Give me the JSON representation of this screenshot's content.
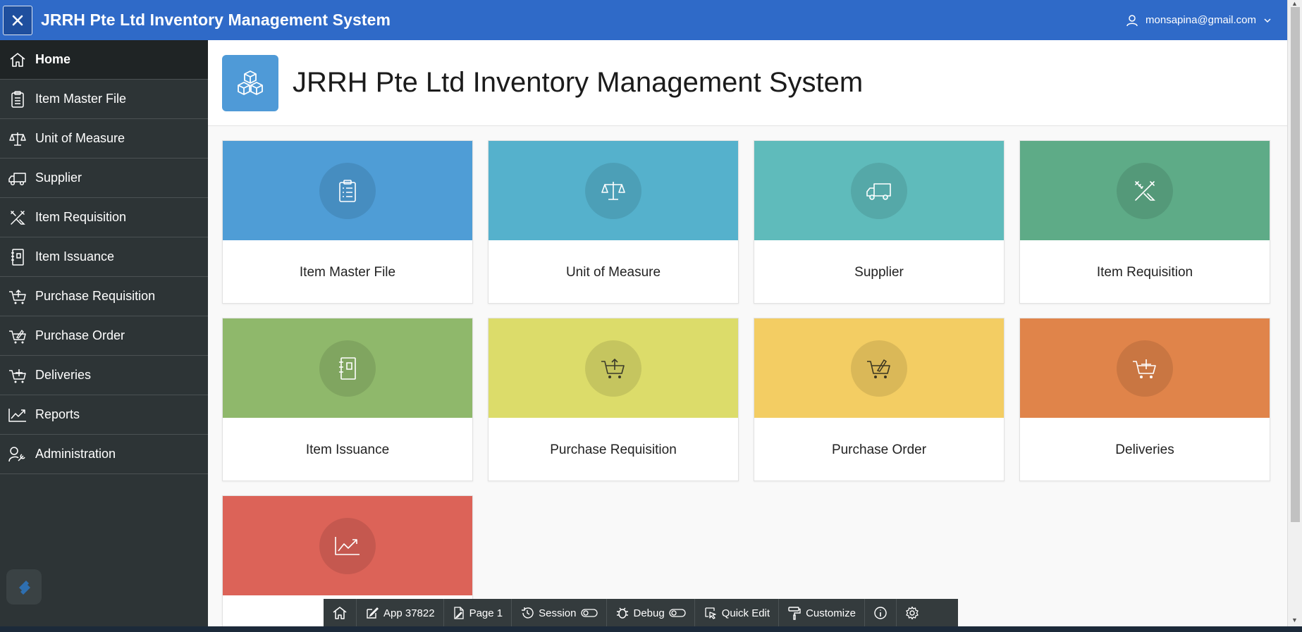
{
  "header": {
    "title": "JRRH Pte Ltd Inventory Management System",
    "user_email": "monsapina@gmail.com"
  },
  "sidebar": {
    "items": [
      {
        "label": "Home",
        "icon": "home-icon",
        "active": true
      },
      {
        "label": "Item Master File",
        "icon": "clipboard-list-icon"
      },
      {
        "label": "Unit of Measure",
        "icon": "balance-scale-icon"
      },
      {
        "label": "Supplier",
        "icon": "truck-icon"
      },
      {
        "label": "Item Requisition",
        "icon": "pencil-ruler-icon"
      },
      {
        "label": "Item Issuance",
        "icon": "notebook-icon"
      },
      {
        "label": "Purchase Requisition",
        "icon": "cart-upload-icon"
      },
      {
        "label": "Purchase Order",
        "icon": "cart-edit-icon"
      },
      {
        "label": "Deliveries",
        "icon": "cart-add-icon"
      },
      {
        "label": "Reports",
        "icon": "line-chart-icon"
      },
      {
        "label": "Administration",
        "icon": "user-wrench-icon"
      }
    ]
  },
  "hero": {
    "title": "JRRH Pte Ltd Inventory Management System",
    "icon": "cubes-icon"
  },
  "cards": [
    {
      "label": "Item Master File",
      "color": "#4f9dd6",
      "icon": "clipboard-list-icon"
    },
    {
      "label": "Unit of Measure",
      "color": "#55b1cc",
      "icon": "balance-scale-icon"
    },
    {
      "label": "Supplier",
      "color": "#5fbbbb",
      "icon": "truck-icon"
    },
    {
      "label": "Item Requisition",
      "color": "#5eab87",
      "icon": "pencil-ruler-icon"
    },
    {
      "label": "Item Issuance",
      "color": "#8fb86b",
      "icon": "notebook-icon"
    },
    {
      "label": "Purchase Requisition",
      "color": "#dcdc6a",
      "icon": "cart-upload-icon"
    },
    {
      "label": "Purchase Order",
      "color": "#f3cd63",
      "icon": "cart-edit-icon"
    },
    {
      "label": "Deliveries",
      "color": "#e0844a",
      "icon": "cart-add-icon"
    },
    {
      "label": "",
      "color": "#dc6358",
      "icon": "line-chart-icon"
    }
  ],
  "devbar": {
    "app": "App 37822",
    "page": "Page 1",
    "session": "Session",
    "debug": "Debug",
    "quick_edit": "Quick Edit",
    "customize": "Customize"
  }
}
